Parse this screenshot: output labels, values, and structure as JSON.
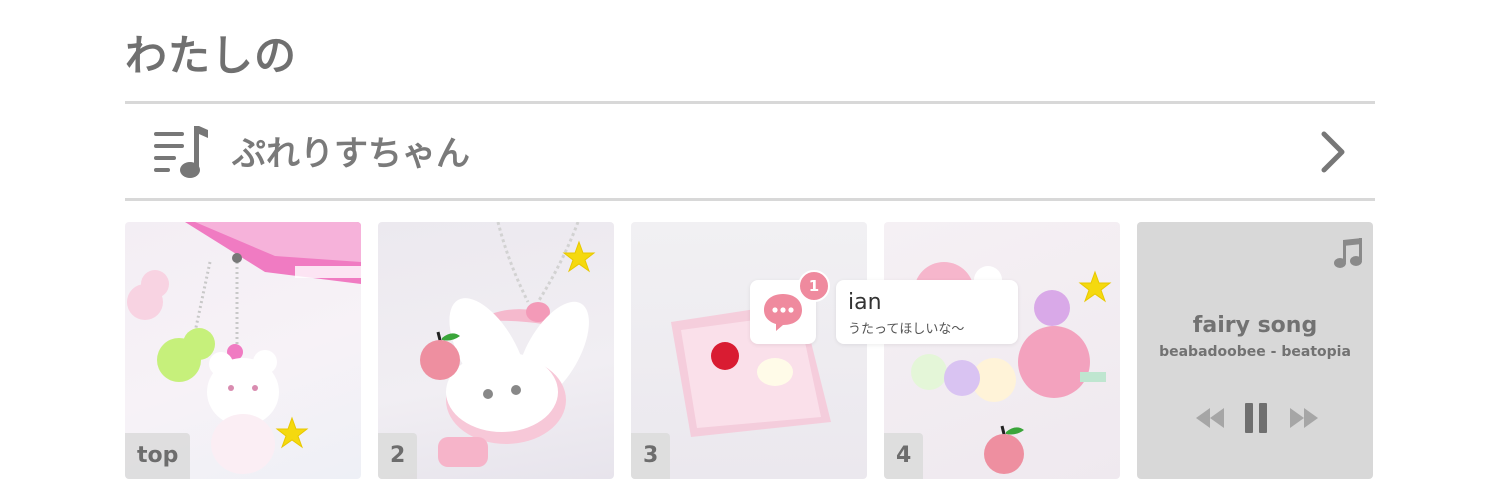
{
  "header": {
    "title": "わたしの"
  },
  "playlist": {
    "label": "ぷれりすちゃん",
    "icon": "playlist-icon",
    "chevron_icon": "chevron-right-icon"
  },
  "cards": [
    {
      "tag": "top"
    },
    {
      "tag": "2"
    },
    {
      "tag": "3"
    },
    {
      "tag": "4"
    }
  ],
  "notification": {
    "name": "ian",
    "message": "うたってほしいな～",
    "badge_count": "1",
    "icon": "chat-bubble-icon",
    "accent": "#ef8a9e"
  },
  "now_playing": {
    "title": "fairy song",
    "artist": "beabadoobee - beatopia",
    "icon": "music-note-icon",
    "controls": [
      "rewind-icon",
      "pause-icon",
      "fast-forward-icon"
    ]
  },
  "colors": {
    "text": "#707070",
    "rule": "#d8d8d8",
    "card_player_bg": "#d8d8d8",
    "star": "#f5d90f",
    "apple": "#ee8fa0",
    "pink": "#f4a7c4"
  }
}
